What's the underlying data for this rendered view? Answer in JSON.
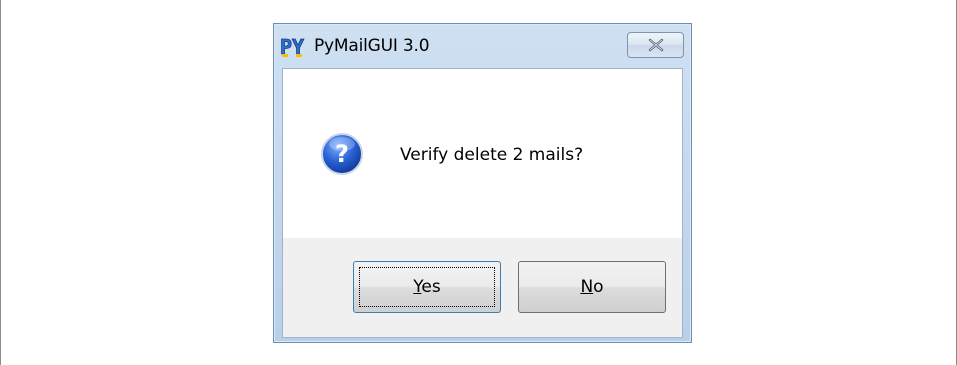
{
  "dialog": {
    "title": "PyMailGUI 3.0",
    "app_icon": "python-logo-icon",
    "close_icon": "close-x-icon",
    "message_icon": "question-icon",
    "message": "Verify delete 2 mails?",
    "buttons": {
      "yes": {
        "mnemonic": "Y",
        "rest": "es"
      },
      "no": {
        "mnemonic": "N",
        "rest": "o"
      }
    }
  }
}
